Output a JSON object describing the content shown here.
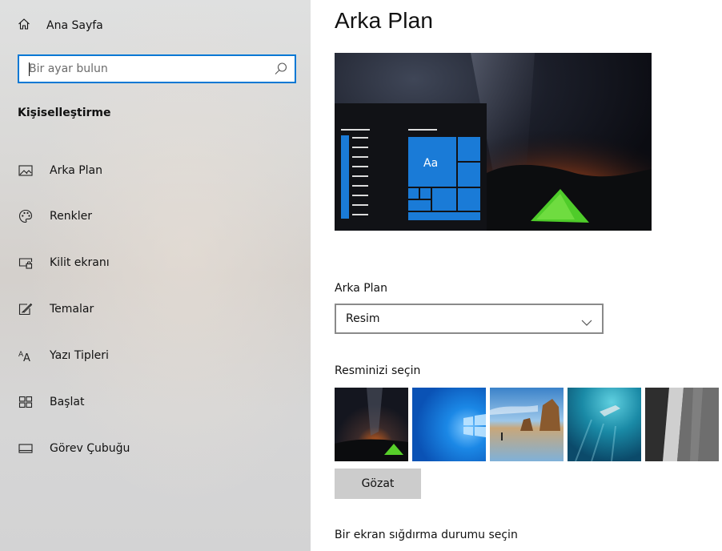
{
  "sidebar": {
    "home_label": "Ana Sayfa",
    "search_placeholder": "Bir ayar bulun",
    "section_title": "Kişiselleştirme",
    "items": [
      {
        "label": "Arka Plan",
        "icon": "picture-icon"
      },
      {
        "label": "Renkler",
        "icon": "palette-icon"
      },
      {
        "label": "Kilit ekranı",
        "icon": "lock-screen-icon"
      },
      {
        "label": "Temalar",
        "icon": "themes-icon"
      },
      {
        "label": "Yazı Tipleri",
        "icon": "fonts-icon"
      },
      {
        "label": "Başlat",
        "icon": "start-icon"
      },
      {
        "label": "Görev Çubuğu",
        "icon": "taskbar-icon"
      }
    ]
  },
  "main": {
    "title": "Arka Plan",
    "preview": {
      "tile_text": "Aa"
    },
    "background_label": "Arka Plan",
    "background_value": "Resim",
    "choose_picture_label": "Resminizi seçin",
    "thumbnails": [
      "night-sky-tent",
      "windows-blue",
      "beach-rocks",
      "underwater-swimmer",
      "rock-waterfall"
    ],
    "browse_label": "Gözat",
    "fit_label": "Bir ekran sığdırma durumu seçin"
  },
  "colors": {
    "accent": "#0078d4",
    "button_gray": "#cccccc"
  }
}
